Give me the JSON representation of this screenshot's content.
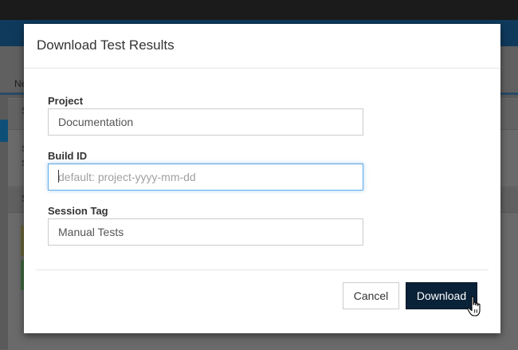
{
  "background": {
    "tab_label": "Ne",
    "panel_letters": [
      "S",
      "S",
      "S",
      "S"
    ]
  },
  "dialog": {
    "title": "Download Test Results",
    "fields": {
      "project": {
        "label": "Project",
        "value": "Documentation",
        "placeholder": ""
      },
      "build_id": {
        "label": "Build ID",
        "value": "",
        "placeholder": "default: project-yyyy-mm-dd"
      },
      "session_tag": {
        "label": "Session Tag",
        "value": "Manual Tests",
        "placeholder": ""
      }
    },
    "buttons": {
      "cancel": "Cancel",
      "download": "Download"
    }
  },
  "colors": {
    "primary_button": "#0a2238",
    "focus_ring": "#66afe9",
    "navbar": "#0f3a5c"
  },
  "icons": {
    "cursor": "hand-pointer-cursor"
  }
}
